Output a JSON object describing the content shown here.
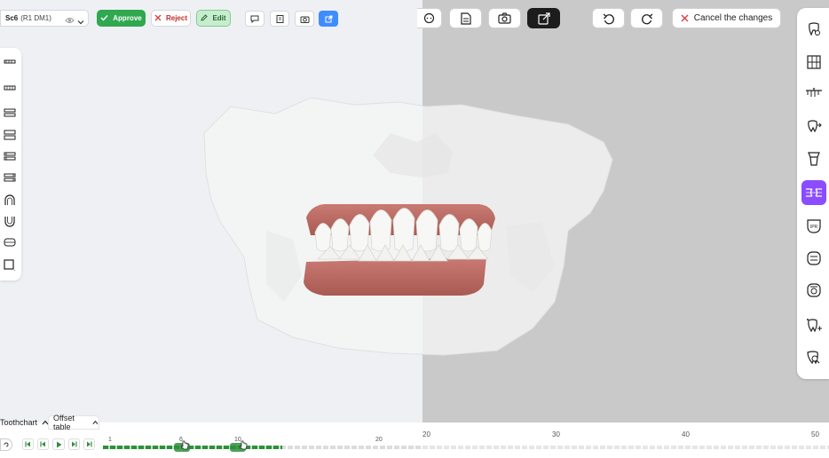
{
  "toolbar": {
    "scene_name": "Sc6",
    "scene_meta": "(R1 DM1)",
    "approve_label": "Approve",
    "reject_label": "Reject",
    "edit_label": "Edit",
    "cancel_label": "Cancel the changes"
  },
  "colors": {
    "approve": "#2fa84f",
    "reject_x": "#d33c3c",
    "edit_bg": "#c9ecd0",
    "accent_blue": "#3f8cff",
    "accent_purple": "#8a4dff",
    "progress_green": "#2e8f3b"
  },
  "left_tools": [
    {
      "icon": "upper-jaw-view-icon"
    },
    {
      "icon": "lower-jaw-view-icon"
    },
    {
      "icon": "front-view-icon"
    },
    {
      "icon": "jaws-open-view-icon"
    },
    {
      "icon": "left-view-icon"
    },
    {
      "icon": "right-view-icon"
    },
    {
      "icon": "upper-arch-occlusal-icon"
    },
    {
      "icon": "lower-arch-occlusal-icon"
    },
    {
      "icon": "both-arches-icon"
    },
    {
      "icon": "square-view-icon"
    }
  ],
  "right_tools": [
    {
      "icon": "tooth-tool-icon",
      "label": ""
    },
    {
      "icon": "grid-teeth-icon",
      "label": ""
    },
    {
      "icon": "attachment-tool-icon",
      "label": ""
    },
    {
      "icon": "tooth-movement-icon",
      "label": ""
    },
    {
      "icon": "crown-tool-icon",
      "label": ""
    },
    {
      "icon": "arch-compare-icon",
      "label": "",
      "active": true
    },
    {
      "icon": "ipr-tool-icon",
      "label": "IPR"
    },
    {
      "icon": "occlusion-icon",
      "label": ""
    },
    {
      "icon": "tooth-target-icon",
      "label": ""
    },
    {
      "icon": "tooth-scan-icon",
      "label": ""
    },
    {
      "icon": "tooth-search-icon",
      "label": ""
    }
  ],
  "bottom": {
    "toothchart_label": "Toothchart",
    "offset_label": "Offset table",
    "ticks_left": [
      "1",
      "6",
      "10",
      "20"
    ],
    "ticks_right": [
      "20",
      "30",
      "40",
      "50"
    ],
    "stages_progress": 0.56
  }
}
